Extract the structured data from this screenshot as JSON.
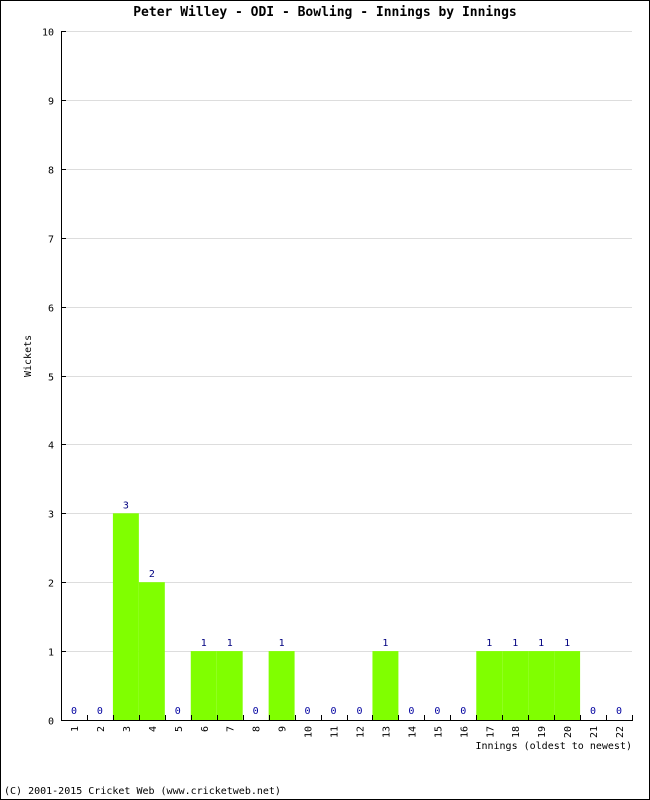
{
  "chart_data": {
    "type": "bar",
    "title": "Peter Willey - ODI - Bowling - Innings by Innings",
    "xlabel": "Innings (oldest to newest)",
    "ylabel": "Wickets",
    "ylim": [
      0,
      10
    ],
    "yticks": [
      0,
      1,
      2,
      3,
      4,
      5,
      6,
      7,
      8,
      9,
      10
    ],
    "grid": true,
    "categories": [
      "1",
      "2",
      "3",
      "4",
      "5",
      "6",
      "7",
      "8",
      "9",
      "10",
      "11",
      "12",
      "13",
      "14",
      "15",
      "16",
      "17",
      "18",
      "19",
      "20",
      "21",
      "22"
    ],
    "values": [
      0,
      0,
      3,
      2,
      0,
      1,
      1,
      0,
      1,
      0,
      0,
      0,
      1,
      0,
      0,
      0,
      1,
      1,
      1,
      1,
      0,
      0
    ],
    "colors": {
      "bar": "#80ff00",
      "grid": "#dddddd",
      "axis": "#000000",
      "value_label": "#000080",
      "zero_label": "#0000a0"
    }
  },
  "footer": "(C) 2001-2015 Cricket Web (www.cricketweb.net)"
}
